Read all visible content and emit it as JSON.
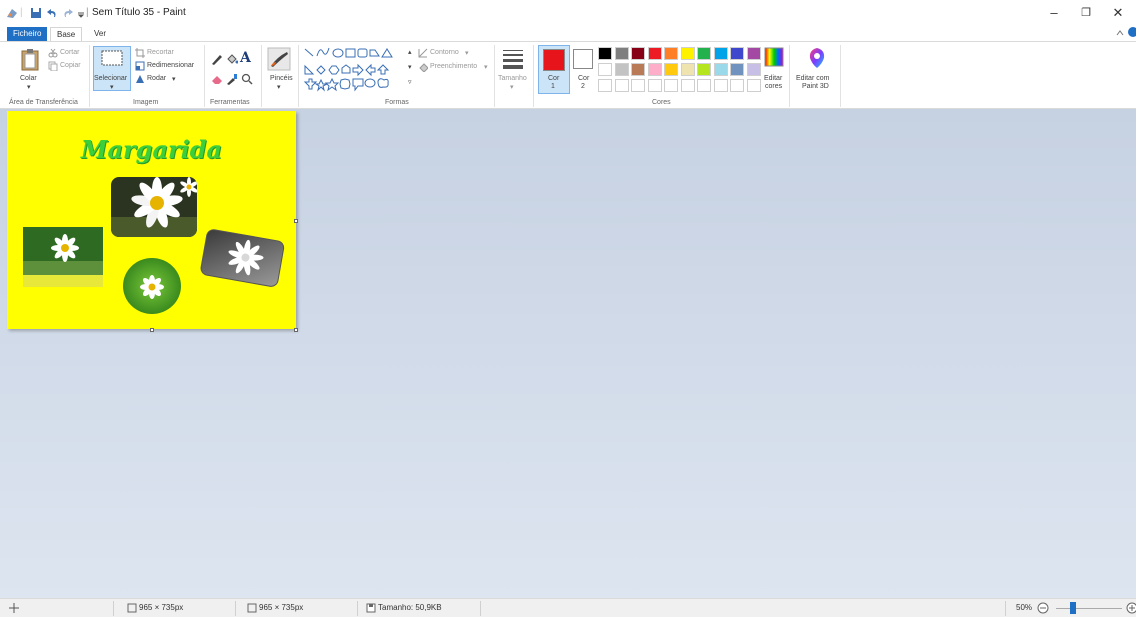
{
  "window": {
    "title": "Sem Título 35 - Paint",
    "minimize": "–",
    "maximize": "❐",
    "close": "✕"
  },
  "tabs": [
    {
      "label": "Ficheiro"
    },
    {
      "label": "Base"
    },
    {
      "label": "Ver"
    }
  ],
  "clipboard": {
    "paste": "Colar",
    "cut": "Cortar",
    "copy": "Copiar",
    "group": "Área de Transferência"
  },
  "image": {
    "select": "Selecionar",
    "crop": "Recortar",
    "resize": "Redimensionar",
    "rotate": "Rodar",
    "group": "Imagem"
  },
  "tools": {
    "group": "Ferramentas",
    "text_tool": "A"
  },
  "brushes": {
    "label": "Pincéis"
  },
  "shapes": {
    "outline": "Contorno",
    "fill": "Preenchimento",
    "group": "Formas"
  },
  "size": {
    "label": "Tamanho"
  },
  "colors": {
    "color1_label": "Cor",
    "color1_num": "1",
    "color1": "#e8141c",
    "color2_label": "Cor",
    "color2_num": "2",
    "color2": "#ffffff",
    "edit": "Editar",
    "edit2": "cores",
    "group": "Cores",
    "palette_row1": [
      "#000000",
      "#7f7f7f",
      "#880015",
      "#ed1c24",
      "#ff7f27",
      "#fff200",
      "#22b14c",
      "#00a2e8",
      "#3f48cc",
      "#a349a4"
    ],
    "palette_row2": [
      "#ffffff",
      "#c3c3c3",
      "#b97a57",
      "#ffaec9",
      "#ffc90e",
      "#efe4b0",
      "#b5e61d",
      "#99d9ea",
      "#7092be",
      "#c8bfe7"
    ]
  },
  "paint3d": {
    "label1": "Editar com",
    "label2": "Paint 3D"
  },
  "canvas": {
    "title": "Margarida",
    "background": "#ffff00"
  },
  "status": {
    "selection_size": "965 × 735px",
    "image_size": "965 × 735px",
    "file_size": "Tamanho: 50,9KB",
    "zoom": "50%"
  }
}
